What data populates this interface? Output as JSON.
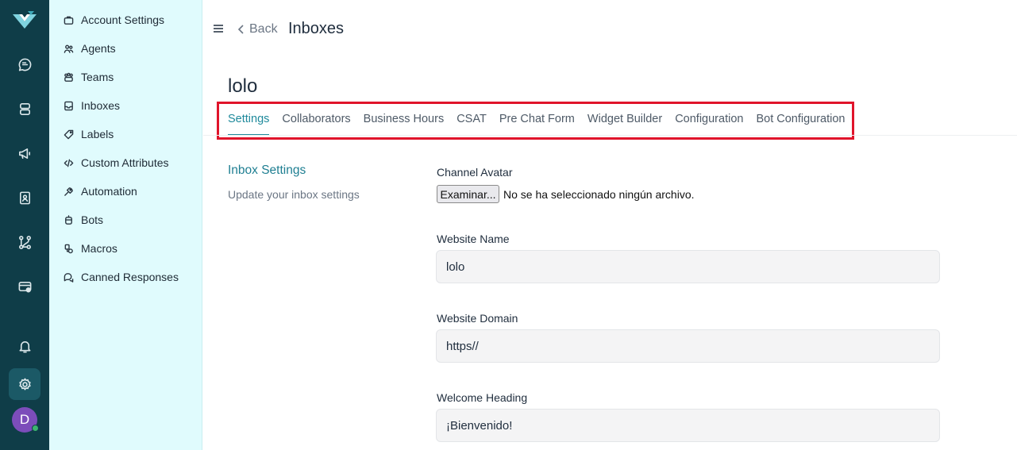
{
  "rail": {
    "icons": [
      "conversations-icon",
      "contacts-icon",
      "campaigns-icon",
      "reports-icon",
      "integrations-icon",
      "billing-icon",
      "notifications-icon",
      "settings-icon"
    ],
    "avatar_initial": "D",
    "colors": {
      "background": "#0f3d48",
      "active": "#1b5966",
      "avatar": "#7c4dba",
      "online": "#3cb46e"
    }
  },
  "sidebar": {
    "items": [
      {
        "label": "Account Settings",
        "icon": "briefcase-icon"
      },
      {
        "label": "Agents",
        "icon": "people-icon"
      },
      {
        "label": "Teams",
        "icon": "team-icon"
      },
      {
        "label": "Inboxes",
        "icon": "inbox-icon"
      },
      {
        "label": "Labels",
        "icon": "tag-icon"
      },
      {
        "label": "Custom Attributes",
        "icon": "code-icon"
      },
      {
        "label": "Automation",
        "icon": "automation-icon"
      },
      {
        "label": "Bots",
        "icon": "bot-icon"
      },
      {
        "label": "Macros",
        "icon": "macro-icon"
      },
      {
        "label": "Canned Responses",
        "icon": "chat-bubbles-icon"
      }
    ],
    "colors": {
      "background": "#e0fbfd"
    }
  },
  "header": {
    "back_label": "Back",
    "title": "Inboxes"
  },
  "inbox": {
    "name": "lolo"
  },
  "tabs": [
    {
      "label": "Settings",
      "active": true
    },
    {
      "label": "Collaborators"
    },
    {
      "label": "Business Hours"
    },
    {
      "label": "CSAT"
    },
    {
      "label": "Pre Chat Form"
    },
    {
      "label": "Widget Builder"
    },
    {
      "label": "Configuration"
    },
    {
      "label": "Bot Configuration"
    }
  ],
  "section": {
    "title": "Inbox Settings",
    "subtitle": "Update your inbox settings"
  },
  "form": {
    "channel_avatar_label": "Channel Avatar",
    "file_button_label": "Examinar...",
    "file_status": "No se ha seleccionado ningún archivo.",
    "website_name_label": "Website Name",
    "website_name_value": "lolo",
    "website_domain_label": "Website Domain",
    "website_domain_value": "https//",
    "welcome_heading_label": "Welcome Heading",
    "welcome_heading_value": "¡Bienvenido!"
  },
  "colors": {
    "accent": "#1f8a9c",
    "highlight_box": "#e0142b"
  }
}
